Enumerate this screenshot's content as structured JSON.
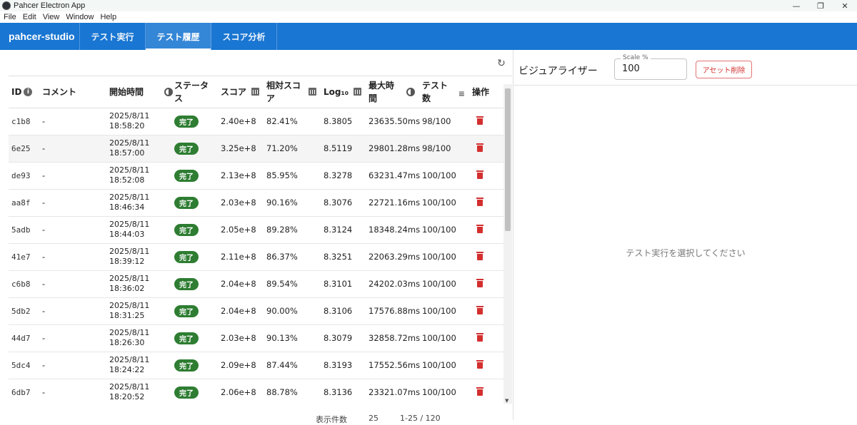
{
  "window": {
    "title": "Pahcer Electron App",
    "minimize": "—",
    "maximize": "❐",
    "close": "✕"
  },
  "menu": [
    "File",
    "Edit",
    "View",
    "Window",
    "Help"
  ],
  "appbar": {
    "brand": "pahcer-studio",
    "tabs": [
      {
        "label": "テスト実行",
        "active": false
      },
      {
        "label": "テスト履歴",
        "active": true
      },
      {
        "label": "スコア分析",
        "active": false
      }
    ]
  },
  "table": {
    "headers": {
      "id": "ID",
      "comment": "コメント",
      "start": "開始時間",
      "status": "ステータス",
      "score": "スコア",
      "relative": "相対スコア",
      "log10": "Log₁₀",
      "max_time": "最大時間",
      "tests": "テスト数",
      "ops": "操作"
    },
    "rows": [
      {
        "id": "c1b8",
        "comment": "-",
        "date": "2025/8/11",
        "time": "18:58:20",
        "status": "完了",
        "score": "2.40e+8",
        "relative": "82.41%",
        "log10": "8.3805",
        "max_time": "23635.50ms",
        "tests": "98/100"
      },
      {
        "id": "6e25",
        "comment": "-",
        "date": "2025/8/11",
        "time": "18:57:00",
        "status": "完了",
        "score": "3.25e+8",
        "relative": "71.20%",
        "log10": "8.5119",
        "max_time": "29801.28ms",
        "tests": "98/100"
      },
      {
        "id": "de93",
        "comment": "-",
        "date": "2025/8/11",
        "time": "18:52:08",
        "status": "完了",
        "score": "2.13e+8",
        "relative": "85.95%",
        "log10": "8.3278",
        "max_time": "63231.47ms",
        "tests": "100/100"
      },
      {
        "id": "aa8f",
        "comment": "-",
        "date": "2025/8/11",
        "time": "18:46:34",
        "status": "完了",
        "score": "2.03e+8",
        "relative": "90.16%",
        "log10": "8.3076",
        "max_time": "22721.16ms",
        "tests": "100/100"
      },
      {
        "id": "5adb",
        "comment": "-",
        "date": "2025/8/11",
        "time": "18:44:03",
        "status": "完了",
        "score": "2.05e+8",
        "relative": "89.28%",
        "log10": "8.3124",
        "max_time": "18348.24ms",
        "tests": "100/100"
      },
      {
        "id": "41e7",
        "comment": "-",
        "date": "2025/8/11",
        "time": "18:39:12",
        "status": "完了",
        "score": "2.11e+8",
        "relative": "86.37%",
        "log10": "8.3251",
        "max_time": "22063.29ms",
        "tests": "100/100"
      },
      {
        "id": "c6b8",
        "comment": "-",
        "date": "2025/8/11",
        "time": "18:36:02",
        "status": "完了",
        "score": "2.04e+8",
        "relative": "89.54%",
        "log10": "8.3101",
        "max_time": "24202.03ms",
        "tests": "100/100"
      },
      {
        "id": "5db2",
        "comment": "-",
        "date": "2025/8/11",
        "time": "18:31:25",
        "status": "完了",
        "score": "2.04e+8",
        "relative": "90.00%",
        "log10": "8.3106",
        "max_time": "17576.88ms",
        "tests": "100/100"
      },
      {
        "id": "44d7",
        "comment": "-",
        "date": "2025/8/11",
        "time": "18:26:30",
        "status": "完了",
        "score": "2.03e+8",
        "relative": "90.13%",
        "log10": "8.3079",
        "max_time": "32858.72ms",
        "tests": "100/100"
      },
      {
        "id": "5dc4",
        "comment": "-",
        "date": "2025/8/11",
        "time": "18:24:22",
        "status": "完了",
        "score": "2.09e+8",
        "relative": "87.44%",
        "log10": "8.3193",
        "max_time": "17552.56ms",
        "tests": "100/100"
      },
      {
        "id": "6db7",
        "comment": "-",
        "date": "2025/8/11",
        "time": "18:20:52",
        "status": "完了",
        "score": "2.06e+8",
        "relative": "88.78%",
        "log10": "8.3136",
        "max_time": "23321.07ms",
        "tests": "100/100"
      }
    ],
    "pager": {
      "rows_per_page_label": "表示件数",
      "rows_per_page": "25",
      "range": "1-25 / 120"
    }
  },
  "visualizer": {
    "title": "ビジュアライザー",
    "scale_label": "Scale %",
    "scale_value": "100",
    "delete_assets": "アセット削除",
    "empty_message": "テスト実行を選択してください"
  },
  "colors": {
    "primary": "#1976d2",
    "success": "#2e7d32",
    "danger": "#d32f2f"
  },
  "icons": {
    "refresh": "↻",
    "info": "i",
    "sort": "≡"
  }
}
